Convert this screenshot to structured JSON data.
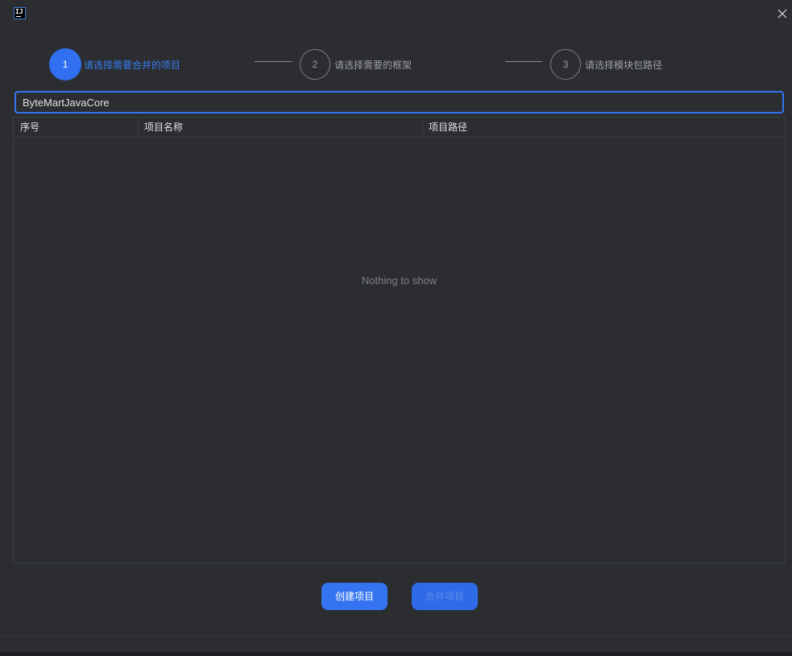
{
  "window": {
    "logo_text": "IJ",
    "close_icon": "close-icon"
  },
  "stepper": {
    "steps": [
      {
        "number": "1",
        "label": "请选择需要合并的项目",
        "state": "active"
      },
      {
        "number": "2",
        "label": "请选择需要的框架",
        "state": "inactive"
      },
      {
        "number": "3",
        "label": "请选择模块包路径",
        "state": "inactive"
      }
    ]
  },
  "search": {
    "value": "ByteMartJavaCore"
  },
  "table": {
    "columns": [
      "序号",
      "项目名称",
      "项目路径"
    ],
    "rows": [],
    "empty_text": "Nothing to show"
  },
  "buttons": {
    "create_label": "创建项目",
    "merge_label": "合并项目"
  },
  "colors": {
    "accent": "#3574f0",
    "background": "#2b2d30"
  }
}
